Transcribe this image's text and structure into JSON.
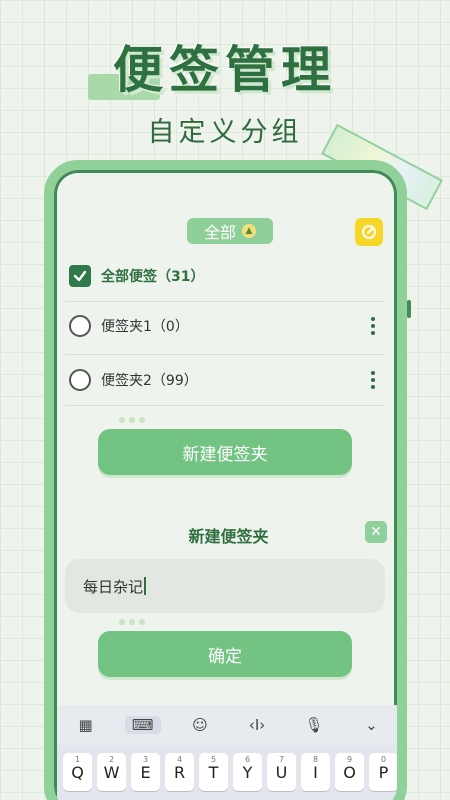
{
  "hero": {
    "title": "便签管理",
    "subtitle": "自定义分组"
  },
  "header": {
    "filter_label": "全部",
    "filter_icon": "chevron-up-icon",
    "edit_icon": "edit-icon"
  },
  "folders": [
    {
      "label": "全部便签（31）",
      "checked": true
    },
    {
      "label": "便签夹1（0）",
      "checked": false
    },
    {
      "label": "便签夹2（99）",
      "checked": false
    }
  ],
  "new_folder_button": "新建便签夹",
  "dialog": {
    "title": "新建便签夹",
    "close_icon": "close-icon",
    "input_value": "每日杂记",
    "confirm_label": "确定"
  },
  "keyboard": {
    "toolbar": [
      "grid-icon",
      "keyboard-icon",
      "emoji-icon",
      "cursor-icon",
      "microphone-icon",
      "chevron-down-icon"
    ],
    "row1": [
      "Q",
      "W",
      "E",
      "R",
      "T",
      "Y",
      "U",
      "I",
      "O",
      "P"
    ],
    "row1_sub": [
      "1",
      "2",
      "3",
      "4",
      "5",
      "6",
      "7",
      "8",
      "9",
      "0"
    ]
  },
  "colors": {
    "accent": "#73c483",
    "dark_green": "#2f7040",
    "frame": "#8fd199",
    "edit_yellow": "#f6d626"
  }
}
